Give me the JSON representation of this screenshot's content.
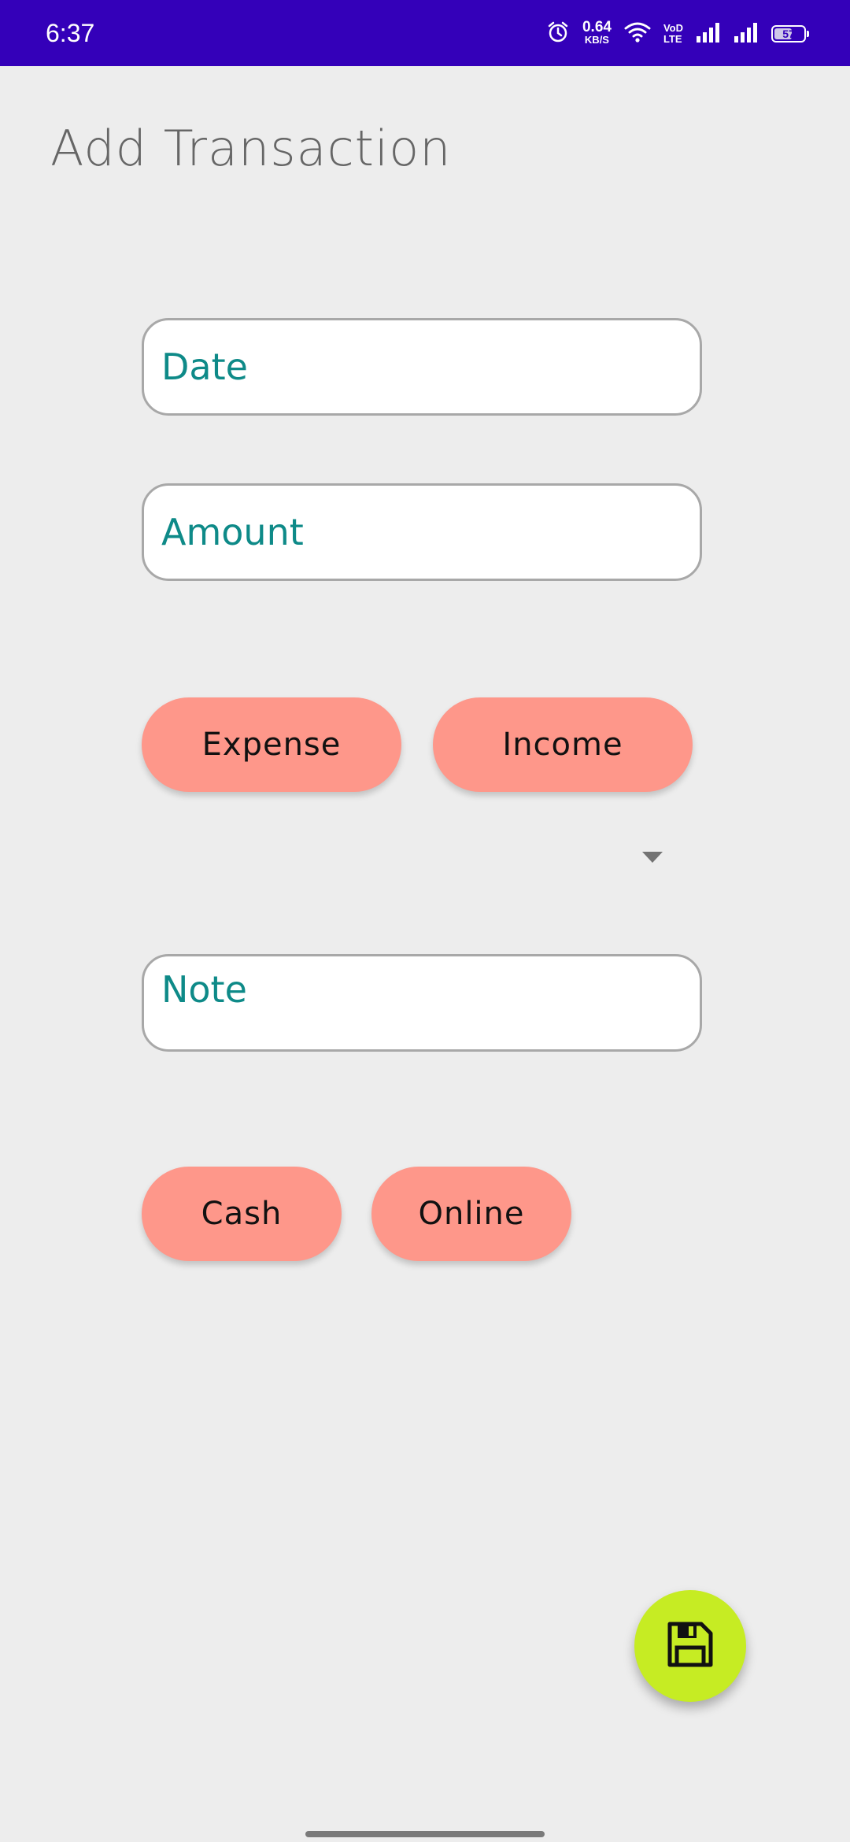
{
  "status_bar": {
    "time": "6:37",
    "net_speed_value": "0.64",
    "net_speed_unit": "KB/S",
    "volte_top": "VoD",
    "volte_bottom": "LTE",
    "battery_level": "57",
    "background_color": "#3400b9",
    "icons": [
      "alarm-icon",
      "wifi-icon",
      "volte-icon",
      "signal-icon",
      "signal-icon",
      "battery-icon"
    ]
  },
  "page": {
    "title": "Add Transaction"
  },
  "form": {
    "date_placeholder": "Date",
    "amount_placeholder": "Amount",
    "note_placeholder": "Note",
    "type_buttons": {
      "expense": "Expense",
      "income": "Income"
    },
    "category_dropdown": {
      "selected": ""
    },
    "payment_buttons": {
      "cash": "Cash",
      "online": "Online"
    }
  },
  "fab": {
    "icon": "save-icon",
    "color": "#c6ec23"
  },
  "colors": {
    "accent_pill": "#fe978a",
    "placeholder_text": "#0e8a88",
    "background": "#ededed"
  }
}
